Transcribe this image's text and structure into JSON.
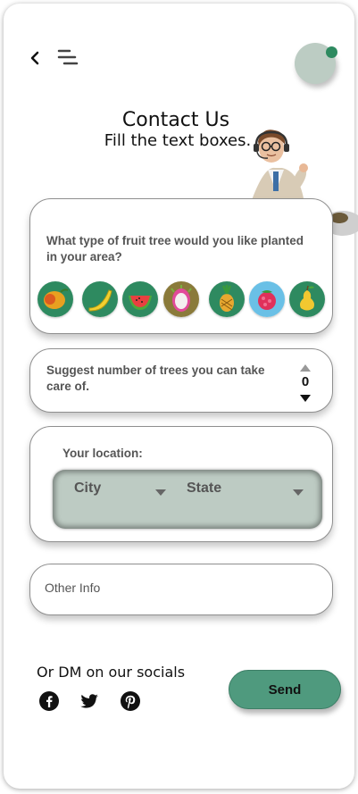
{
  "header": {
    "title": "Contact Us",
    "subtitle": "Fill  the text boxes."
  },
  "fruit_card": {
    "question": "What type of fruit tree would you like planted in your area?",
    "options": [
      {
        "name": "mango",
        "bg": "#2e8a60"
      },
      {
        "name": "banana",
        "bg": "#2e8a60"
      },
      {
        "name": "watermelon",
        "bg": "#2e8a60"
      },
      {
        "name": "dragon-fruit",
        "bg": "#8a7a3a"
      },
      {
        "name": "pineapple",
        "bg": "#2e8a60"
      },
      {
        "name": "raspberry",
        "bg": "#6ac0e6"
      },
      {
        "name": "pear",
        "bg": "#2e8a60"
      }
    ]
  },
  "trees_card": {
    "question": "Suggest number of trees you can take care of.",
    "count": "0"
  },
  "location_card": {
    "label": "Your location:",
    "city": "City",
    "state": "State"
  },
  "other_info": {
    "placeholder": "Other Info"
  },
  "socials": {
    "text": "Or DM on our socials",
    "icons": [
      "facebook-icon",
      "twitter-icon",
      "pinterest-icon"
    ]
  },
  "send": {
    "label": "Send"
  },
  "colors": {
    "accent": "#4f9a7e",
    "status_dot": "#2e8a60",
    "location_box": "#bdcbc3",
    "avatar": "#bcccc3"
  }
}
